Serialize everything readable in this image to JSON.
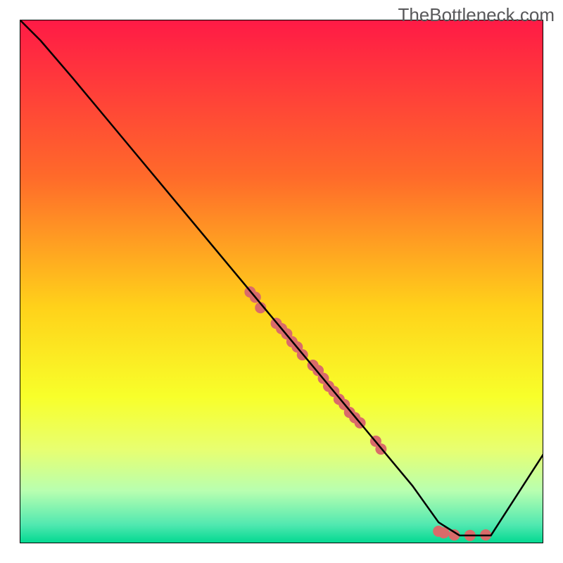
{
  "watermark": "TheBottleneck.com",
  "chart_data": {
    "type": "line",
    "title": "",
    "xlabel": "",
    "ylabel": "",
    "xlim": [
      0,
      100
    ],
    "ylim": [
      0,
      100
    ],
    "x": [
      0,
      4,
      10,
      20,
      30,
      40,
      50,
      55,
      60,
      65,
      70,
      75,
      80,
      84,
      90,
      100
    ],
    "y": [
      100,
      96,
      89,
      77,
      65,
      53,
      41,
      35,
      29,
      23,
      17,
      11,
      4,
      1.5,
      1.5,
      17
    ],
    "scatter": [
      {
        "x": 44,
        "y": 48
      },
      {
        "x": 45,
        "y": 47
      },
      {
        "x": 46,
        "y": 45
      },
      {
        "x": 49,
        "y": 42
      },
      {
        "x": 50,
        "y": 41
      },
      {
        "x": 51,
        "y": 40
      },
      {
        "x": 52,
        "y": 38.5
      },
      {
        "x": 53,
        "y": 37.5
      },
      {
        "x": 54,
        "y": 36
      },
      {
        "x": 56,
        "y": 34
      },
      {
        "x": 57,
        "y": 33
      },
      {
        "x": 58,
        "y": 31.5
      },
      {
        "x": 59,
        "y": 30
      },
      {
        "x": 60,
        "y": 29
      },
      {
        "x": 61,
        "y": 27.5
      },
      {
        "x": 62,
        "y": 26.5
      },
      {
        "x": 63,
        "y": 25
      },
      {
        "x": 64,
        "y": 24
      },
      {
        "x": 65,
        "y": 23
      },
      {
        "x": 68,
        "y": 19.5
      },
      {
        "x": 69,
        "y": 18
      },
      {
        "x": 80,
        "y": 2.3
      },
      {
        "x": 81,
        "y": 2.0
      },
      {
        "x": 83,
        "y": 1.6
      },
      {
        "x": 86,
        "y": 1.5
      },
      {
        "x": 89,
        "y": 1.6
      }
    ],
    "gradient_stops": [
      {
        "offset": 0,
        "color": "#ff1a46"
      },
      {
        "offset": 0.3,
        "color": "#ff6a2a"
      },
      {
        "offset": 0.55,
        "color": "#ffd21a"
      },
      {
        "offset": 0.72,
        "color": "#f8ff2a"
      },
      {
        "offset": 0.82,
        "color": "#e8ff70"
      },
      {
        "offset": 0.9,
        "color": "#b8ffb0"
      },
      {
        "offset": 0.965,
        "color": "#50e8b0"
      },
      {
        "offset": 1.0,
        "color": "#00d890"
      }
    ],
    "point_color": "#d96b6a",
    "line_color": "#000000"
  }
}
